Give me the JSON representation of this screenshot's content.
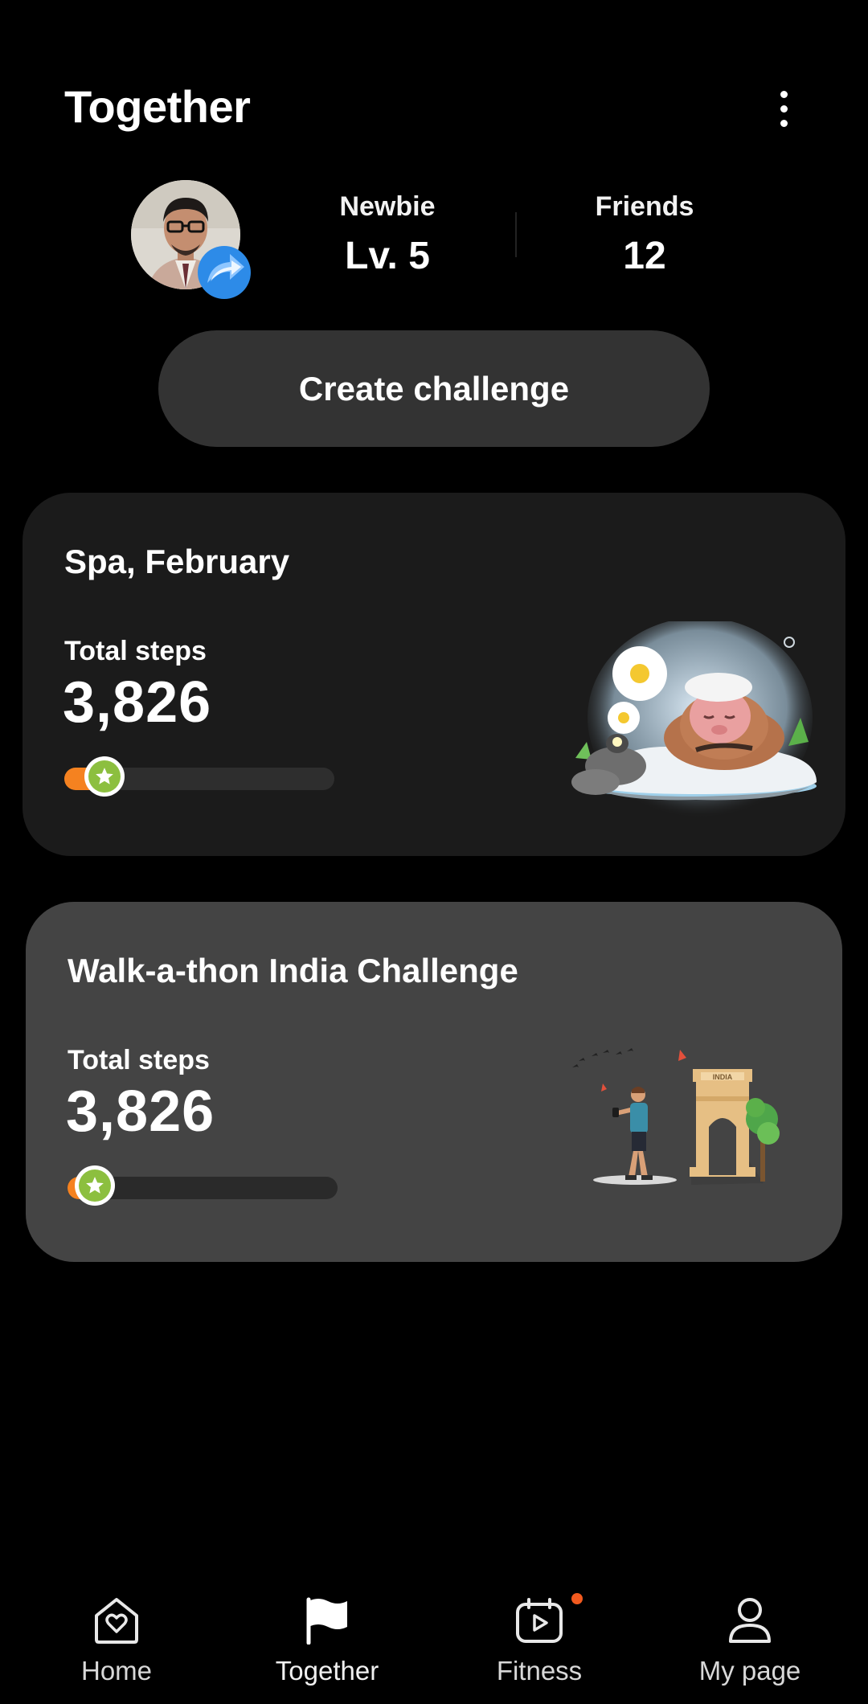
{
  "header": {
    "title": "Together",
    "more_icon": "more-vertical-icon"
  },
  "profile": {
    "level": {
      "label": "Newbie",
      "value": "Lv. 5"
    },
    "friends": {
      "label": "Friends",
      "value": "12"
    },
    "share_icon": "share-arrow-icon"
  },
  "create_challenge": {
    "label": "Create challenge"
  },
  "challenges": [
    {
      "title": "Spa, February",
      "steps_label": "Total steps",
      "steps_value": "3,826",
      "progress": 0.15,
      "illustration": "spa-monkey-illustration"
    },
    {
      "title": "Walk-a-thon India Challenge",
      "steps_label": "Total steps",
      "steps_value": "3,826",
      "progress": 0.1,
      "illustration": "india-gate-illustration",
      "illustration_text": "INDIA"
    }
  ],
  "nav": {
    "items": [
      {
        "label": "Home",
        "icon": "home-heart-icon"
      },
      {
        "label": "Together",
        "icon": "flag-icon",
        "active": true
      },
      {
        "label": "Fitness",
        "icon": "fitness-play-icon",
        "badge": true
      },
      {
        "label": "My page",
        "icon": "person-icon"
      }
    ]
  },
  "colors": {
    "background": "#000000",
    "card_dark": "#1b1b1b",
    "card_gray": "#444444",
    "button": "#333333",
    "progress_fill": "#f58220",
    "progress_star": "#8cbf3f",
    "badge": "#f25a1f"
  }
}
